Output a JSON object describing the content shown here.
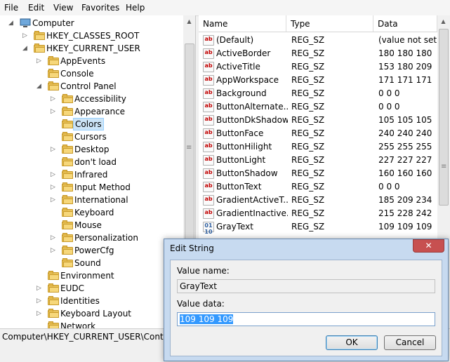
{
  "menu": [
    "File",
    "Edit",
    "View",
    "Favorites",
    "Help"
  ],
  "tree": {
    "items": [
      {
        "label": "Computer",
        "expander": "◢",
        "icon": "computer"
      },
      {
        "label": "HKEY_CLASSES_ROOT",
        "expander": "▷",
        "icon": "folder"
      },
      {
        "label": "HKEY_CURRENT_USER",
        "expander": "◢",
        "icon": "folder"
      },
      {
        "label": "AppEvents",
        "expander": "▷",
        "icon": "folder"
      },
      {
        "label": "Console",
        "expander": "",
        "icon": "folder"
      },
      {
        "label": "Control Panel",
        "expander": "◢",
        "icon": "folder"
      },
      {
        "label": "Accessibility",
        "expander": "▷",
        "icon": "folder"
      },
      {
        "label": "Appearance",
        "expander": "▷",
        "icon": "folder"
      },
      {
        "label": "Colors",
        "expander": "",
        "icon": "folder"
      },
      {
        "label": "Cursors",
        "expander": "",
        "icon": "folder"
      },
      {
        "label": "Desktop",
        "expander": "▷",
        "icon": "folder"
      },
      {
        "label": "don't load",
        "expander": "",
        "icon": "folder"
      },
      {
        "label": "Infrared",
        "expander": "▷",
        "icon": "folder"
      },
      {
        "label": "Input Method",
        "expander": "▷",
        "icon": "folder"
      },
      {
        "label": "International",
        "expander": "▷",
        "icon": "folder"
      },
      {
        "label": "Keyboard",
        "expander": "",
        "icon": "folder"
      },
      {
        "label": "Mouse",
        "expander": "",
        "icon": "folder"
      },
      {
        "label": "Personalization",
        "expander": "▷",
        "icon": "folder"
      },
      {
        "label": "PowerCfg",
        "expander": "▷",
        "icon": "folder"
      },
      {
        "label": "Sound",
        "expander": "",
        "icon": "folder"
      },
      {
        "label": "Environment",
        "expander": "",
        "icon": "folder"
      },
      {
        "label": "EUDC",
        "expander": "▷",
        "icon": "folder"
      },
      {
        "label": "Identities",
        "expander": "▷",
        "icon": "folder"
      },
      {
        "label": "Keyboard Layout",
        "expander": "▷",
        "icon": "folder"
      },
      {
        "label": "Network",
        "expander": "",
        "icon": "folder"
      }
    ],
    "selected": "Colors"
  },
  "list": {
    "columns": [
      "Name",
      "Type",
      "Data"
    ],
    "rows": [
      {
        "name": "(Default)",
        "type": "REG_SZ",
        "data": "(value not set)",
        "icon": "ab"
      },
      {
        "name": "ActiveBorder",
        "type": "REG_SZ",
        "data": "180 180 180",
        "icon": "ab"
      },
      {
        "name": "ActiveTitle",
        "type": "REG_SZ",
        "data": "153 180 209",
        "icon": "ab"
      },
      {
        "name": "AppWorkspace",
        "type": "REG_SZ",
        "data": "171 171 171",
        "icon": "ab"
      },
      {
        "name": "Background",
        "type": "REG_SZ",
        "data": "0 0 0",
        "icon": "ab"
      },
      {
        "name": "ButtonAlternate...",
        "type": "REG_SZ",
        "data": "0 0 0",
        "icon": "ab"
      },
      {
        "name": "ButtonDkShadow",
        "type": "REG_SZ",
        "data": "105 105 105",
        "icon": "ab"
      },
      {
        "name": "ButtonFace",
        "type": "REG_SZ",
        "data": "240 240 240",
        "icon": "ab"
      },
      {
        "name": "ButtonHilight",
        "type": "REG_SZ",
        "data": "255 255 255",
        "icon": "ab"
      },
      {
        "name": "ButtonLight",
        "type": "REG_SZ",
        "data": "227 227 227",
        "icon": "ab"
      },
      {
        "name": "ButtonShadow",
        "type": "REG_SZ",
        "data": "160 160 160",
        "icon": "ab"
      },
      {
        "name": "ButtonText",
        "type": "REG_SZ",
        "data": "0 0 0",
        "icon": "ab"
      },
      {
        "name": "GradientActiveT...",
        "type": "REG_SZ",
        "data": "185 209 234",
        "icon": "ab"
      },
      {
        "name": "GradientInactive...",
        "type": "REG_SZ",
        "data": "215 228 242",
        "icon": "ab"
      },
      {
        "name": "GrayText",
        "type": "REG_SZ",
        "data": "109 109 109",
        "icon": "bin"
      }
    ]
  },
  "status": {
    "path": "Computer\\HKEY_CURRENT_USER\\Control"
  },
  "dialog": {
    "title": "Edit String",
    "close": "✕",
    "value_name_label": "Value name:",
    "value_name": "GrayText",
    "value_data_label": "Value data:",
    "value_data": "109 109 109",
    "ok": "OK",
    "cancel": "Cancel"
  }
}
